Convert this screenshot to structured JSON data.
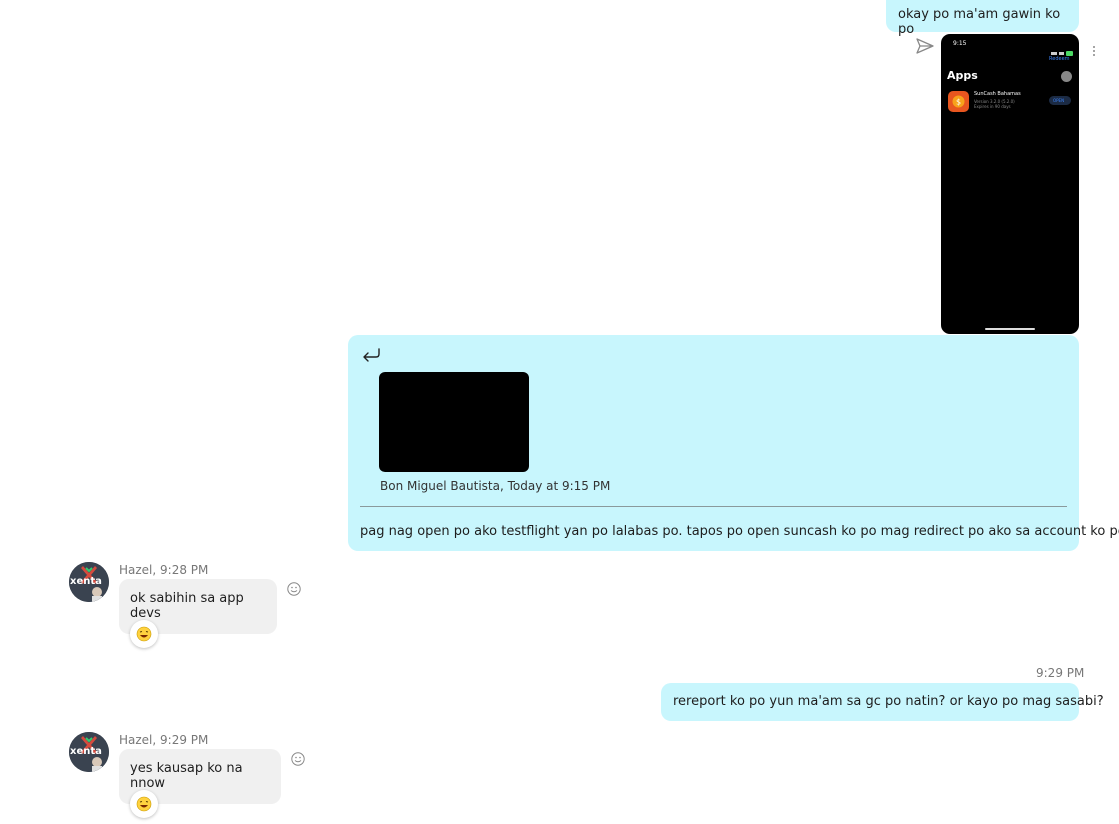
{
  "messages": {
    "m1": {
      "text": "okay po ma'am gawin ko po"
    },
    "screenshot": {
      "status_time": "9:15",
      "redeem_label": "Redeem",
      "section_title": "Apps",
      "app_name": "SunCash Bahamas",
      "app_version": "Version 3.2.0 (5.2.0)",
      "app_expires": "Expires in 90 days",
      "open_label": "OPEN"
    },
    "quote": {
      "attribution": "Bon Miguel Bautista, Today at 9:15 PM",
      "text": "pag nag open po ako testflight yan po lalabas po. tapos po open suncash ko po mag redirect po ako sa account ko po"
    },
    "h1": {
      "sender": "Hazel, 9:28 PM",
      "text": "ok sabihin sa app devs"
    },
    "m3": {
      "time": "9:29 PM",
      "text": "rereport ko po yun ma'am sa gc po natin? or kayo po mag sasabi?"
    },
    "h2": {
      "sender": "Hazel, 9:29 PM",
      "text": "yes kausap ko na nnow"
    }
  },
  "avatar": {
    "text": "xenta"
  },
  "colors": {
    "outgoing": "#c8f6fd",
    "incoming": "#f0f0f0",
    "accent": "#1a73e8"
  }
}
